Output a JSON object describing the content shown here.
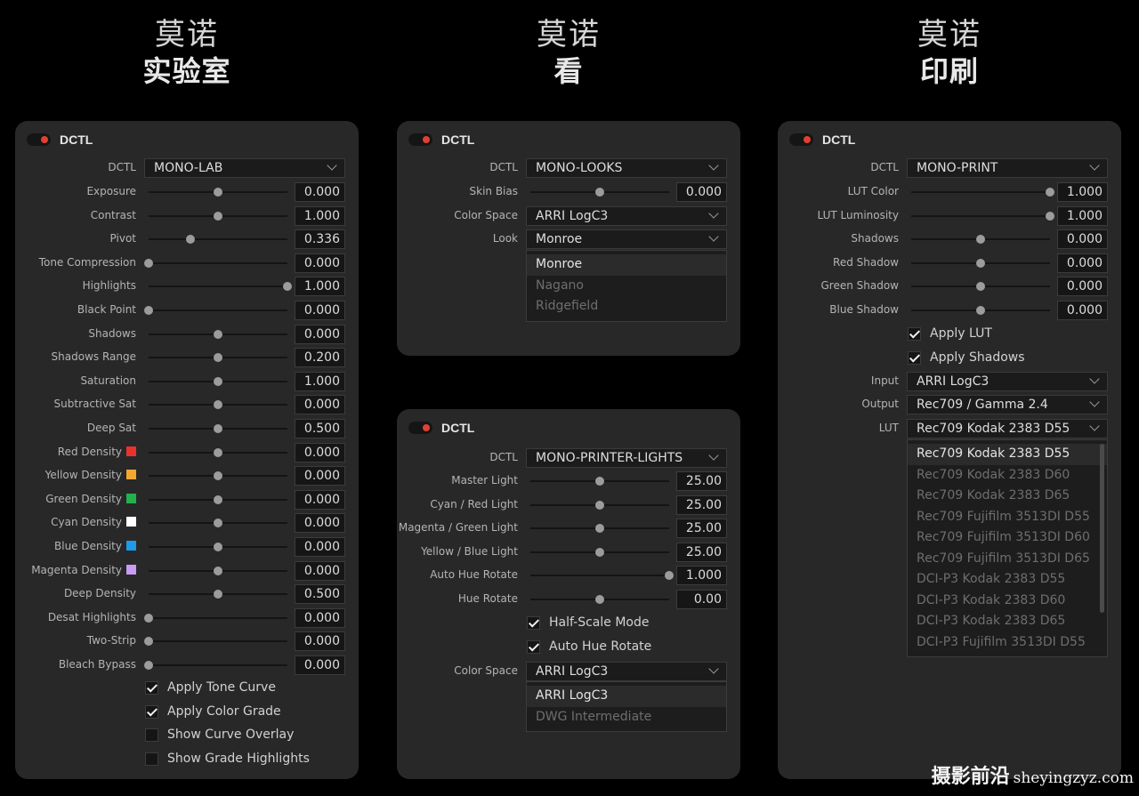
{
  "titles": [
    {
      "line1": "莫诺",
      "line2": "实验室"
    },
    {
      "line1": "莫诺",
      "line2": "看"
    },
    {
      "line1": "莫诺",
      "line2": "印刷"
    }
  ],
  "colors": {
    "red": "#e8322d",
    "yellow": "#f2a830",
    "green": "#22b14c",
    "cyan": "#ffffff",
    "blue": "#1e9be8",
    "magenta": "#c89bf5",
    "toggle_dot": "#e2402f"
  },
  "panel_lab": {
    "header": "DCTL",
    "dctl_label": "DCTL",
    "dctl_value": "MONO-LAB",
    "sliders": [
      {
        "label": "Exposure",
        "value": "0.000",
        "pos": 0.5
      },
      {
        "label": "Contrast",
        "value": "1.000",
        "pos": 0.5
      },
      {
        "label": "Pivot",
        "value": "0.336",
        "pos": 0.3
      },
      {
        "label": "Tone Compression",
        "value": "0.000",
        "pos": 0.0
      },
      {
        "label": "Highlights",
        "value": "1.000",
        "pos": 1.0
      },
      {
        "label": "Black Point",
        "value": "0.000",
        "pos": 0.0
      },
      {
        "label": "Shadows",
        "value": "0.000",
        "pos": 0.5
      },
      {
        "label": "Shadows Range",
        "value": "0.200",
        "pos": 0.5
      },
      {
        "label": "Saturation",
        "value": "1.000",
        "pos": 0.5
      },
      {
        "label": "Subtractive Sat",
        "value": "0.000",
        "pos": 0.5
      },
      {
        "label": "Deep Sat",
        "value": "0.500",
        "pos": 0.5
      },
      {
        "label": "Red Density",
        "value": "0.000",
        "pos": 0.5,
        "swatch": "red"
      },
      {
        "label": "Yellow Density",
        "value": "0.000",
        "pos": 0.5,
        "swatch": "yellow"
      },
      {
        "label": "Green Density",
        "value": "0.000",
        "pos": 0.5,
        "swatch": "green"
      },
      {
        "label": "Cyan Density",
        "value": "0.000",
        "pos": 0.5,
        "swatch": "cyan"
      },
      {
        "label": "Blue Density",
        "value": "0.000",
        "pos": 0.5,
        "swatch": "blue"
      },
      {
        "label": "Magenta Density",
        "value": "0.000",
        "pos": 0.5,
        "swatch": "magenta"
      },
      {
        "label": "Deep Density",
        "value": "0.500",
        "pos": 0.5
      },
      {
        "label": "Desat Highlights",
        "value": "0.000",
        "pos": 0.0
      },
      {
        "label": "Two-Strip",
        "value": "0.000",
        "pos": 0.0
      },
      {
        "label": "Bleach Bypass",
        "value": "0.000",
        "pos": 0.0
      }
    ],
    "checkboxes": [
      {
        "label": "Apply Tone Curve",
        "checked": true
      },
      {
        "label": "Apply Color Grade",
        "checked": true
      },
      {
        "label": "Show Curve Overlay",
        "checked": false
      },
      {
        "label": "Show Grade Highlights",
        "checked": false
      }
    ]
  },
  "panel_looks": {
    "header": "DCTL",
    "dctl_label": "DCTL",
    "dctl_value": "MONO-LOOKS",
    "skin_bias": {
      "label": "Skin Bias",
      "value": "0.000",
      "pos": 0.5
    },
    "color_space": {
      "label": "Color Space",
      "value": "ARRI LogC3"
    },
    "look": {
      "label": "Look",
      "value": "Monroe",
      "options": [
        "Monroe",
        "Nagano",
        "Ridgefield"
      ]
    }
  },
  "panel_printer": {
    "header": "DCTL",
    "dctl_label": "DCTL",
    "dctl_value": "MONO-PRINTER-LIGHTS",
    "sliders": [
      {
        "label": "Master Light",
        "value": "25.00",
        "pos": 0.5
      },
      {
        "label": "Cyan / Red Light",
        "value": "25.00",
        "pos": 0.5
      },
      {
        "label": "Magenta / Green Light",
        "value": "25.00",
        "pos": 0.5
      },
      {
        "label": "Yellow / Blue Light",
        "value": "25.00",
        "pos": 0.5
      },
      {
        "label": "Auto Hue Rotate",
        "value": "1.000",
        "pos": 1.0
      },
      {
        "label": "Hue Rotate",
        "value": "0.00",
        "pos": 0.5
      }
    ],
    "checkboxes": [
      {
        "label": "Half-Scale Mode",
        "checked": true
      },
      {
        "label": "Auto Hue Rotate",
        "checked": true
      }
    ],
    "color_space": {
      "label": "Color Space",
      "value": "ARRI LogC3",
      "options": [
        "ARRI LogC3",
        "DWG Intermediate"
      ]
    }
  },
  "panel_print": {
    "header": "DCTL",
    "dctl_label": "DCTL",
    "dctl_value": "MONO-PRINT",
    "sliders": [
      {
        "label": "LUT Color",
        "value": "1.000",
        "pos": 1.0
      },
      {
        "label": "LUT Luminosity",
        "value": "1.000",
        "pos": 1.0
      },
      {
        "label": "Shadows",
        "value": "0.000",
        "pos": 0.5
      },
      {
        "label": "Red Shadow",
        "value": "0.000",
        "pos": 0.5
      },
      {
        "label": "Green Shadow",
        "value": "0.000",
        "pos": 0.5
      },
      {
        "label": "Blue Shadow",
        "value": "0.000",
        "pos": 0.5
      }
    ],
    "checkboxes": [
      {
        "label": "Apply LUT",
        "checked": true
      },
      {
        "label": "Apply Shadows",
        "checked": true
      }
    ],
    "input": {
      "label": "Input",
      "value": "ARRI LogC3"
    },
    "output": {
      "label": "Output",
      "value": "Rec709 / Gamma 2.4"
    },
    "lut": {
      "label": "LUT",
      "value": "Rec709 Kodak 2383 D55",
      "options": [
        "Rec709 Kodak 2383 D55",
        "Rec709 Kodak 2383 D60",
        "Rec709 Kodak 2383 D65",
        "Rec709 Fujifilm 3513DI D55",
        "Rec709 Fujifilm 3513DI D60",
        "Rec709 Fujifilm 3513DI D65",
        "DCI-P3 Kodak 2383 D55",
        "DCI-P3 Kodak 2383 D60",
        "DCI-P3 Kodak 2383 D65",
        "DCI-P3 Fujifilm 3513DI D55"
      ]
    }
  },
  "watermark": {
    "cn": "摄影前沿",
    "site": "sheyingzyz.com"
  }
}
